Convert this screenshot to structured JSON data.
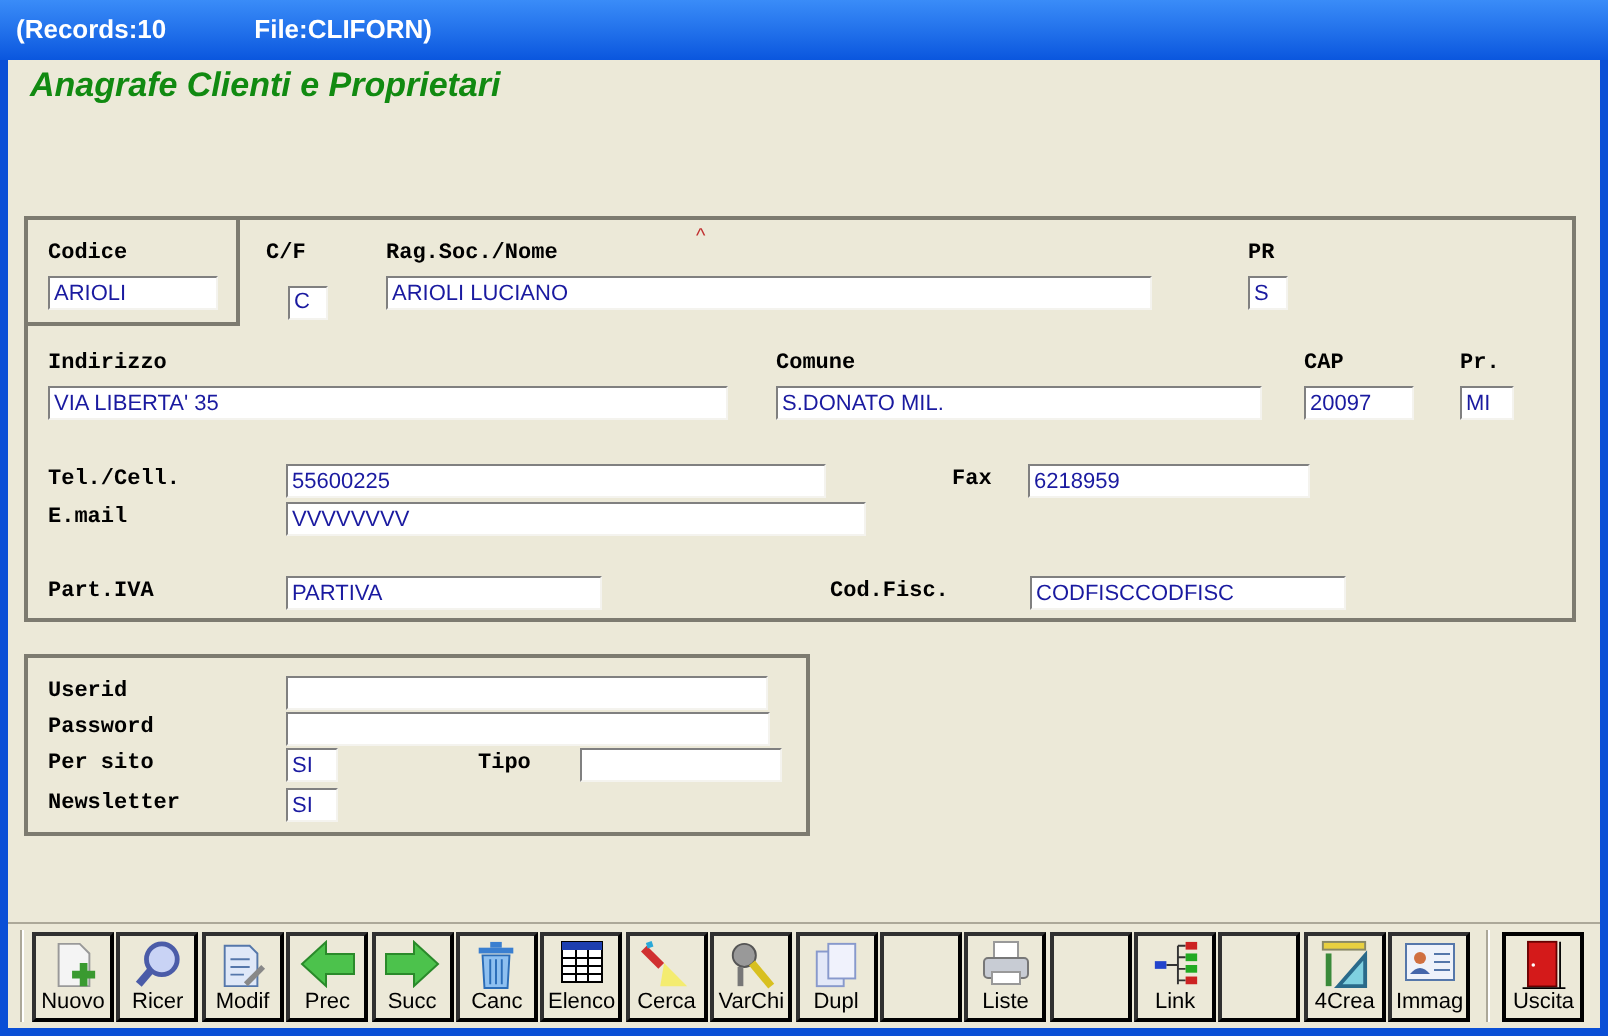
{
  "window": {
    "records": "(Records:10",
    "file": "File:CLIFORN)"
  },
  "form_title": "Anagrafe Clienti e Proprietari",
  "sort_mark": "^",
  "main": {
    "codice": {
      "label": "Codice",
      "value": "ARIOLI"
    },
    "cf": {
      "label": "C/F",
      "value": "C"
    },
    "ragsoc": {
      "label": "Rag.Soc./Nome",
      "value": "ARIOLI LUCIANO"
    },
    "pr": {
      "label": "PR",
      "value": "S"
    },
    "indirizzo": {
      "label": "Indirizzo",
      "value": "VIA LIBERTA' 35"
    },
    "comune": {
      "label": "Comune",
      "value": "S.DONATO MIL."
    },
    "cap": {
      "label": "CAP",
      "value": "20097"
    },
    "prov": {
      "label": "Pr.",
      "value": "MI"
    },
    "tel": {
      "label": "Tel./Cell.",
      "value": "55600225"
    },
    "fax": {
      "label": "Fax",
      "value": "6218959"
    },
    "email": {
      "label": "E.mail",
      "value": "VVVVVVVV"
    },
    "piva": {
      "label": "Part.IVA",
      "value": "PARTIVA"
    },
    "codfisc": {
      "label": "Cod.Fisc.",
      "value": "CODFISCCODFISC"
    }
  },
  "web": {
    "userid": {
      "label": "Userid"
    },
    "password": {
      "label": "Password"
    },
    "persito": {
      "label": "Per sito",
      "value": "SI"
    },
    "tipo": {
      "label": "Tipo"
    },
    "newsletter": {
      "label": "Newsletter",
      "value": "SI"
    }
  },
  "toolbar": [
    {
      "kind": "command",
      "label": "Nuovo"
    },
    {
      "kind": "command",
      "label": "Ricer"
    },
    {
      "kind": "command",
      "label": "Modif"
    },
    {
      "kind": "command",
      "label": "Prec"
    },
    {
      "kind": "command",
      "label": "Succ"
    },
    {
      "kind": "command",
      "label": "Canc"
    },
    {
      "kind": "command",
      "label": "Elenco"
    },
    {
      "kind": "command",
      "label": "Cerca"
    },
    {
      "kind": "command",
      "label": "VarChi"
    },
    {
      "kind": "command",
      "label": "Dupl"
    },
    {
      "kind": "blank"
    },
    {
      "kind": "command",
      "label": "Liste"
    },
    {
      "kind": "blank"
    },
    {
      "kind": "command",
      "label": "Link"
    },
    {
      "kind": "blank"
    },
    {
      "kind": "command",
      "label": "4Crea"
    },
    {
      "kind": "command",
      "label": "Immag"
    }
  ],
  "exit_button": {
    "label": "Uscita"
  }
}
